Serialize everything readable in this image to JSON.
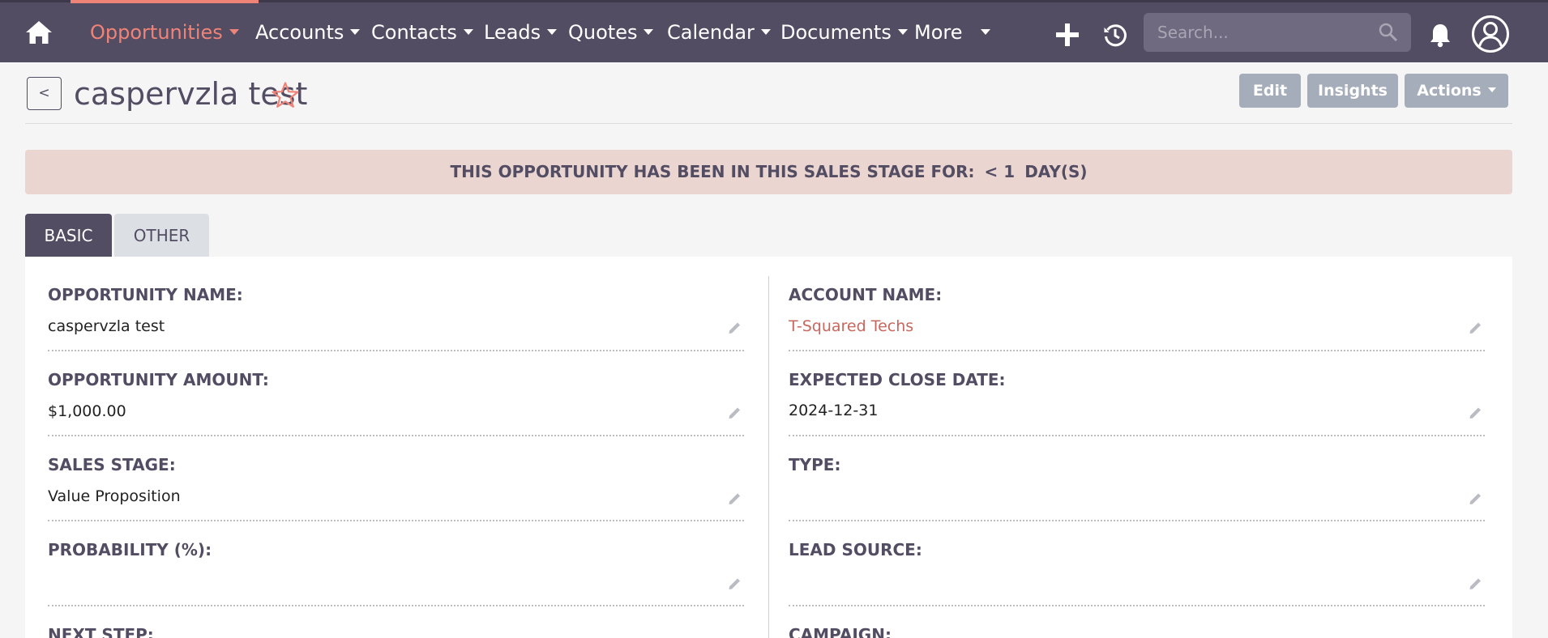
{
  "nav": {
    "items": [
      {
        "label": "Opportunities",
        "active": true
      },
      {
        "label": "Accounts",
        "active": false
      },
      {
        "label": "Contacts",
        "active": false
      },
      {
        "label": "Leads",
        "active": false
      },
      {
        "label": "Quotes",
        "active": false
      },
      {
        "label": "Calendar",
        "active": false
      },
      {
        "label": "Documents",
        "active": false
      },
      {
        "label": "More",
        "active": false
      }
    ],
    "search_placeholder": "Search...",
    "icons": [
      "home-icon",
      "plus-icon",
      "history-icon",
      "search-icon",
      "bell-icon",
      "user-icon"
    ]
  },
  "header": {
    "back_label": "<",
    "title": "caspervzla test",
    "favorite": false,
    "buttons": {
      "edit": "Edit",
      "insights": "Insights",
      "actions": "Actions"
    }
  },
  "banner": {
    "text": "THIS OPPORTUNITY HAS BEEN IN THIS SALES STAGE FOR:",
    "value": "< 1",
    "unit": "DAY(S)"
  },
  "tabs": [
    {
      "label": "BASIC",
      "active": true
    },
    {
      "label": "OTHER",
      "active": false
    }
  ],
  "fields": {
    "left": [
      {
        "label": "OPPORTUNITY NAME:",
        "value": "caspervzla test",
        "link": false
      },
      {
        "label": "OPPORTUNITY AMOUNT:",
        "value": "$1,000.00",
        "link": false
      },
      {
        "label": "SALES STAGE:",
        "value": "Value Proposition",
        "link": false
      },
      {
        "label": "PROBABILITY (%):",
        "value": "",
        "link": false
      },
      {
        "label": "NEXT STEP:",
        "value": "",
        "link": false
      }
    ],
    "right": [
      {
        "label": "ACCOUNT NAME:",
        "value": "T-Squared Techs",
        "link": true
      },
      {
        "label": "EXPECTED CLOSE DATE:",
        "value": "2024-12-31",
        "link": false
      },
      {
        "label": "TYPE:",
        "value": "",
        "link": false
      },
      {
        "label": "LEAD SOURCE:",
        "value": "",
        "link": false
      },
      {
        "label": "CAMPAIGN:",
        "value": "",
        "link": false
      }
    ]
  },
  "colors": {
    "nav_bg": "#534d64",
    "accent": "#f08377",
    "banner_bg": "#ebd5d0",
    "button_bg": "#a5adbb",
    "link": "#c8675d"
  }
}
